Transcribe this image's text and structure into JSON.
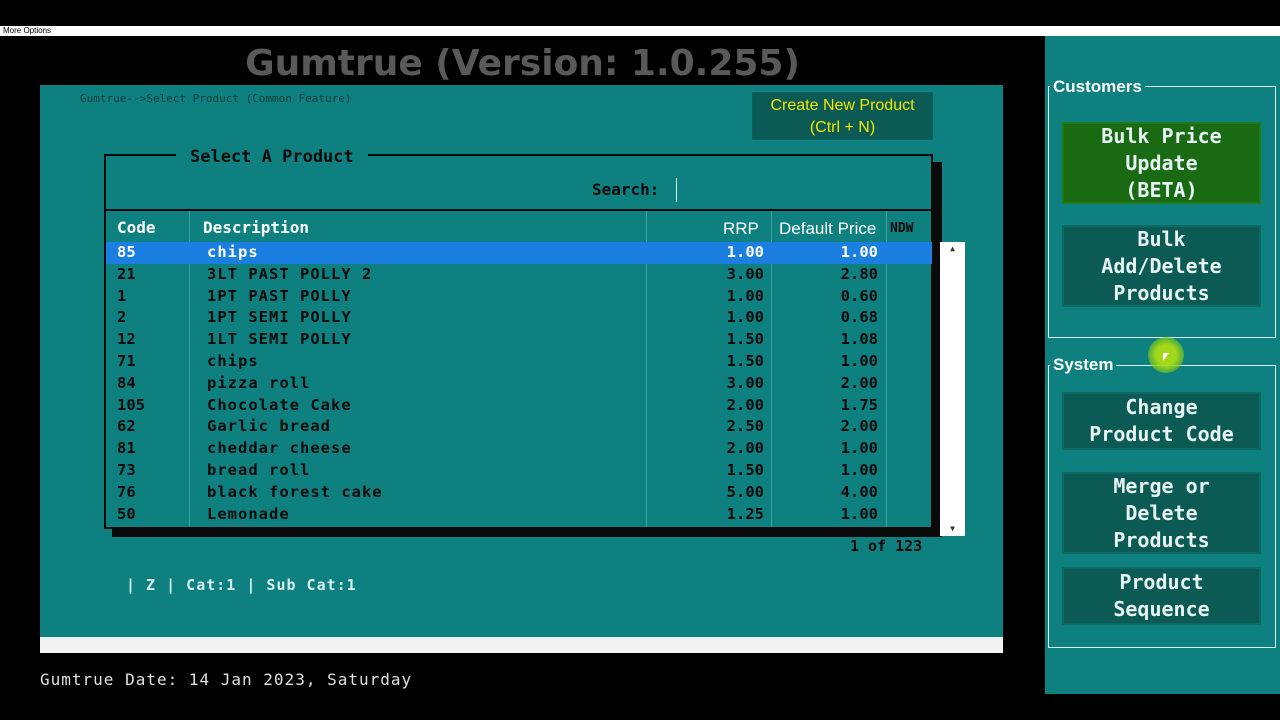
{
  "window": {
    "title": "Gumtrue (Version: 1.0.255)",
    "options_label": "More Options"
  },
  "breadcrumb": "Gumtrue-->Select Product (Common Feature)",
  "create_button": {
    "line1": "Create New Product",
    "line2": "(Ctrl + N)"
  },
  "panel": {
    "title": "Select A Product",
    "search_label": "Search:",
    "search_value": ""
  },
  "columns": {
    "code": "Code",
    "description": "Description",
    "rrp": "RRP",
    "default_price": "Default Price",
    "ndw": "NDW"
  },
  "rows": [
    {
      "code": "85",
      "desc": "chips",
      "rrp": "1.00",
      "price": "1.00",
      "selected": true
    },
    {
      "code": "21",
      "desc": "3LT PAST POLLY 2",
      "rrp": "3.00",
      "price": "2.80"
    },
    {
      "code": "1",
      "desc": "1PT PAST POLLY",
      "rrp": "1.00",
      "price": "0.60"
    },
    {
      "code": "2",
      "desc": "1PT SEMI POLLY",
      "rrp": "1.00",
      "price": "0.68"
    },
    {
      "code": "12",
      "desc": "1LT SEMI POLLY",
      "rrp": "1.50",
      "price": "1.08"
    },
    {
      "code": "71",
      "desc": "chips",
      "rrp": "1.50",
      "price": "1.00"
    },
    {
      "code": "84",
      "desc": "pizza roll",
      "rrp": "3.00",
      "price": "2.00"
    },
    {
      "code": "105",
      "desc": "Chocolate Cake",
      "rrp": "2.00",
      "price": "1.75"
    },
    {
      "code": "62",
      "desc": "Garlic bread",
      "rrp": "2.50",
      "price": "2.00"
    },
    {
      "code": "81",
      "desc": "cheddar cheese",
      "rrp": "2.00",
      "price": "1.00"
    },
    {
      "code": "73",
      "desc": "bread roll",
      "rrp": "1.50",
      "price": "1.00"
    },
    {
      "code": "76",
      "desc": "black forest cake",
      "rrp": "5.00",
      "price": "4.00"
    },
    {
      "code": "50",
      "desc": "Lemonade",
      "rrp": "1.25",
      "price": "1.00"
    }
  ],
  "pager": "1 of 123",
  "category_line": "| Z | Cat:1 | Sub Cat:1",
  "date_line": "Gumtrue Date: 14 Jan 2023, Saturday",
  "sidebar": {
    "customers_label": "Customers",
    "system_label": "System",
    "buttons": {
      "bulk_price": [
        "Bulk Price",
        "Update",
        "(BETA)"
      ],
      "bulk_add": [
        "Bulk",
        "Add/Delete",
        "Products"
      ],
      "change_code": [
        "Change",
        "Product Code"
      ],
      "merge_delete": [
        "Merge or",
        "Delete",
        "Products"
      ],
      "sequence": [
        "Product",
        "Sequence"
      ]
    }
  },
  "colors": {
    "teal": "#0e8080",
    "dark_teal_button": "#0b5a54",
    "green_button": "#1a6a14",
    "selection": "#1a7fe0",
    "create_text": "#f2e600"
  },
  "icons": {
    "scroll_up": "scroll-up-arrow-icon",
    "scroll_down": "scroll-down-arrow-icon",
    "cursor": "mouse-pointer-icon"
  }
}
